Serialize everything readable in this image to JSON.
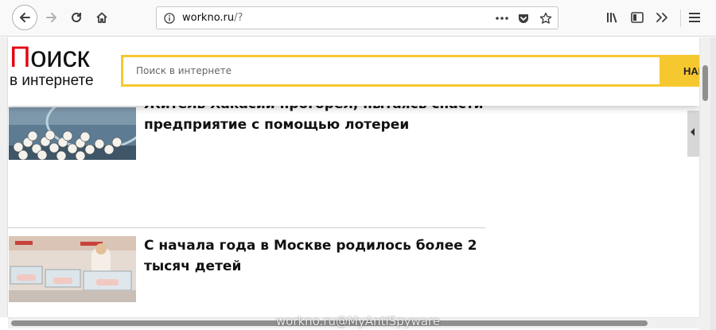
{
  "browser": {
    "url_host": "workno.ru",
    "url_path": "/?"
  },
  "page": {
    "logo_line1_red": "П",
    "logo_line1_rest": "оиск",
    "logo_line2": "в интернете",
    "search_placeholder": "Поиск в интернете",
    "search_button": "НАЙ",
    "articles": [
      {
        "title": "Житель Хакасии прогорел, пытаясь спасти предприятие с помощью лотереи"
      },
      {
        "title": "С начала года в Москве родилось более 2 тысяч детей"
      }
    ]
  },
  "watermark": "workno.ru@MyAntiSpyware",
  "colors": {
    "accent_yellow": "#f6c830",
    "logo_red": "#e30613"
  }
}
